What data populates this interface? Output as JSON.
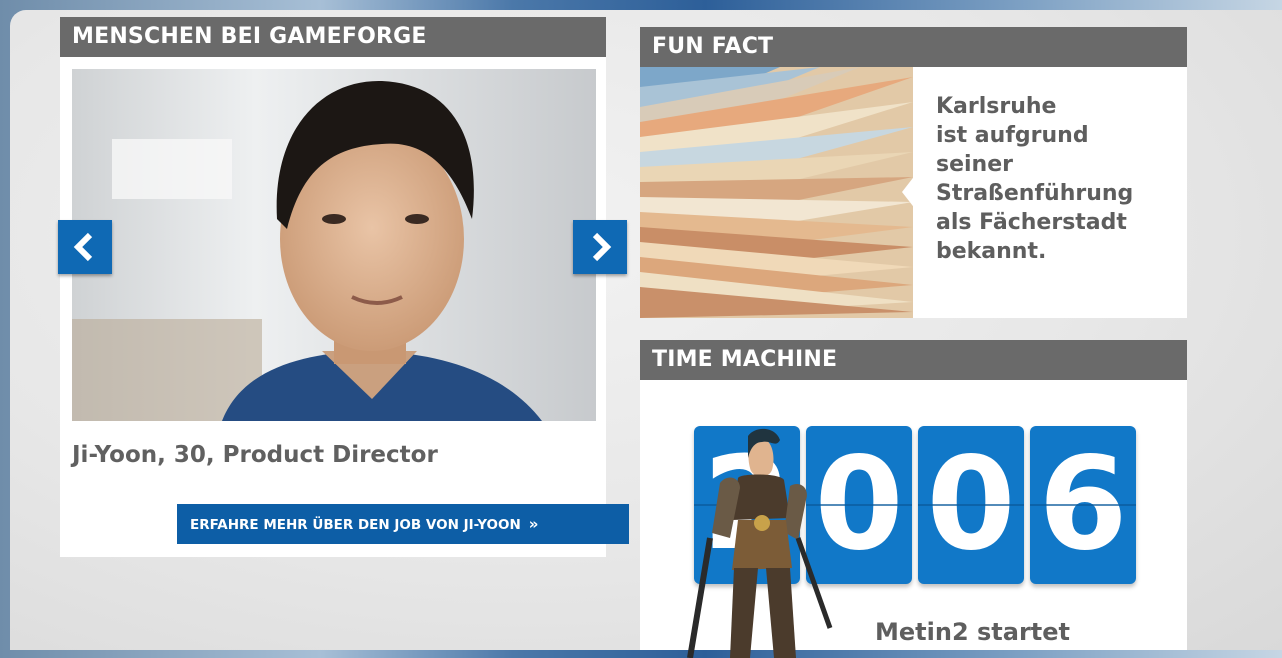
{
  "people": {
    "header": "MENSCHEN BEI GAMEFORGE",
    "caption": "Ji-Yoon, 30, Product Director",
    "link_label": "ERFAHRE MEHR ÜBER DEN JOB VON JI-YOON",
    "prev_icon": "chevron-left-icon",
    "next_icon": "chevron-right-icon"
  },
  "funfact": {
    "header": "FUN FACT",
    "lines": [
      "Karlsruhe",
      "ist aufgrund",
      "seiner",
      "Straßenführung",
      "als Fächerstadt",
      "bekannt."
    ]
  },
  "timemachine": {
    "header": "TIME MACHINE",
    "digits": [
      "2",
      "0",
      "0",
      "6"
    ],
    "caption": "Metin2 startet"
  },
  "colors": {
    "header_bg": "#6a6a6a",
    "accent_blue": "#0f69b4",
    "digit_blue": "#1178c8",
    "text_gray": "#5e5e5e"
  }
}
